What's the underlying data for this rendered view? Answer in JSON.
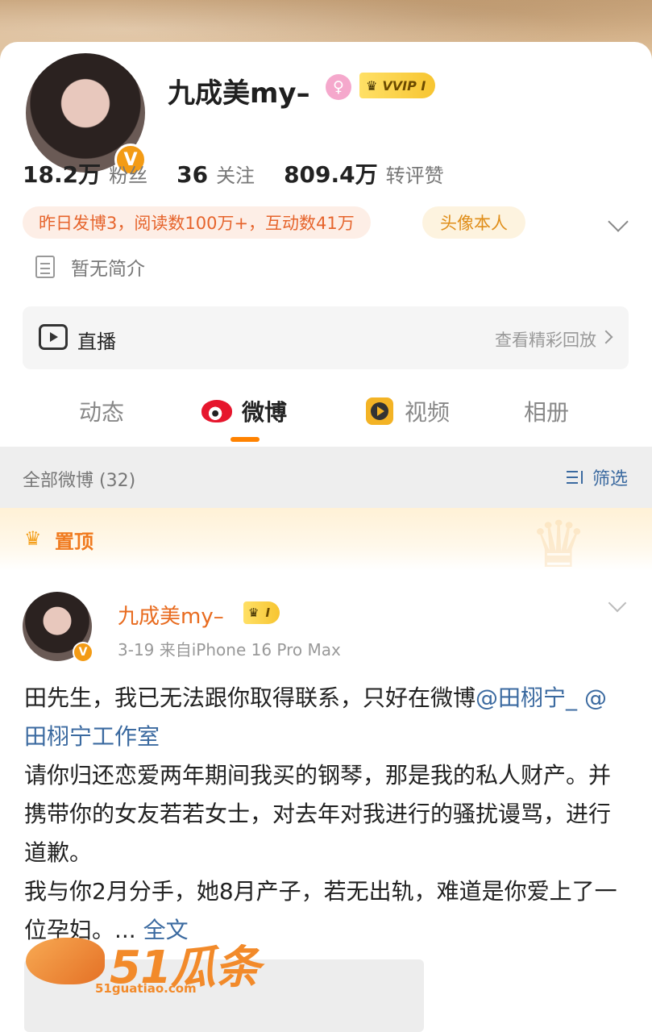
{
  "profile": {
    "name": "九成美my–",
    "gender_symbol": "♀",
    "vip_label": "VVIP I",
    "verified_symbol": "V",
    "stats": [
      {
        "value": "18.2万",
        "label": "粉丝"
      },
      {
        "value": "36",
        "label": "关注"
      },
      {
        "value": "809.4万",
        "label": "转评赞"
      }
    ],
    "activity_tag": "昨日发博3，阅读数100万+，互动数41万",
    "avatar_tag": "头像本人",
    "bio": "暂无简介"
  },
  "live": {
    "title": "直播",
    "link": "查看精彩回放"
  },
  "tabs": [
    {
      "label": "动态"
    },
    {
      "label": "微博"
    },
    {
      "label": "视频"
    },
    {
      "label": "相册"
    }
  ],
  "filter": {
    "all_count": "全部微博 (32)",
    "filter_label": "筛选"
  },
  "pinned": {
    "label": "置顶"
  },
  "post": {
    "author": "九成美my–",
    "badge": "I",
    "meta": "3-19  来自iPhone 16 Pro Max",
    "line1_text": "田先生，我已无法跟你取得联系，只好在微博",
    "mention1": "@田栩宁_",
    "mention2": "@田栩宁工作室",
    "para2": "请你归还恋爱两年期间我买的钢琴，那是我的私人财产。并携带你的女友若若女士，对去年对我进行的骚扰谩骂，进行道歉。",
    "para3": "我与你2月分手，她8月产子，若无出轨，难道是你爱上了一位孕妇。...",
    "full_text": "全文"
  },
  "watermark": {
    "brand": "51瓜条",
    "url": "51guatiao.com"
  },
  "colors": {
    "accent_orange": "#ff8200",
    "link_blue": "#3b6aa0",
    "name_orange": "#e86b1f"
  }
}
